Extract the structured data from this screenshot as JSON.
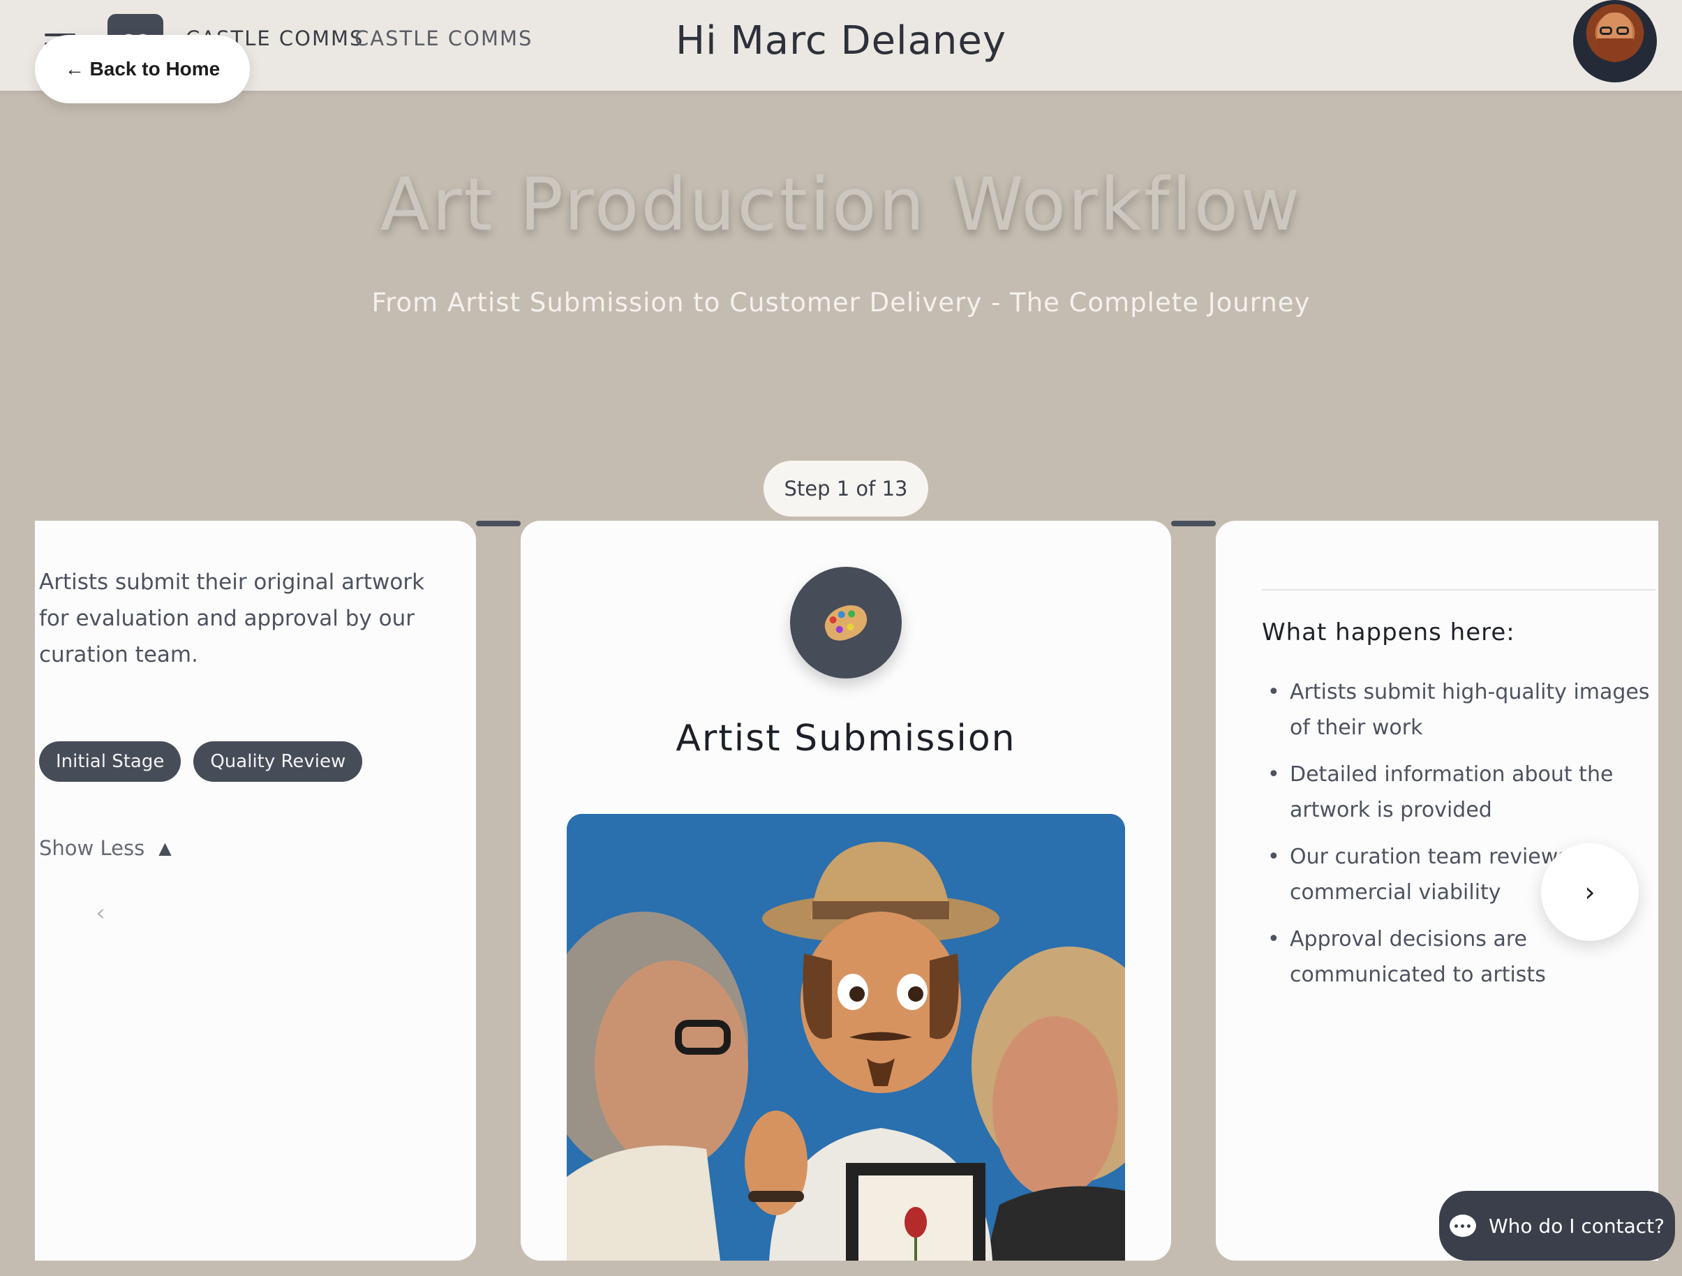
{
  "header": {
    "brand_badge": "CC",
    "brand_name": "CASTLE COMMS",
    "brand_name_secondary": "CASTLE COMMS",
    "greeting": "Hi Marc Delaney",
    "back_label": "← Back to Home"
  },
  "hero": {
    "title": "Art Production Workflow",
    "subtitle": "From Artist Submission to Customer Delivery - The Complete Journey"
  },
  "stepper": {
    "label": "Step 1 of 13",
    "current": 1,
    "total": 13
  },
  "left_card": {
    "description": "Artists submit their original artwork for evaluation and approval by our curation team.",
    "tags": [
      "Initial Stage",
      "Quality Review"
    ],
    "toggle_label": "Show Less",
    "prev_icon": "chevron-left-icon"
  },
  "center_card": {
    "icon": "palette-icon",
    "title": "Artist Submission"
  },
  "right_card": {
    "section_title": "What happens here:",
    "items": [
      "Artists submit high-quality images of their work",
      "Detailed information about the artwork is provided",
      "Our curation team reviews for commercial viability",
      "Approval decisions are communicated to artists"
    ]
  },
  "contact_button": {
    "label": "Who do I contact?"
  },
  "colors": {
    "background": "#c4bcb0",
    "header": "#ebe8e3",
    "accent_dark": "#474c59",
    "card": "#fcfcfc"
  }
}
